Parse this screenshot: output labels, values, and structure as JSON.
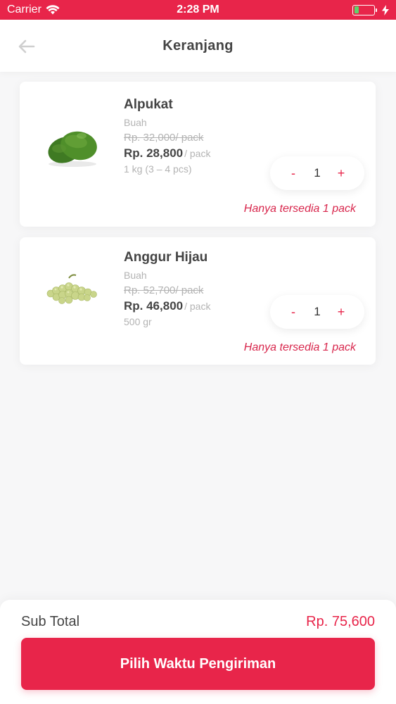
{
  "status_bar": {
    "carrier": "Carrier",
    "time": "2:28 PM",
    "battery_level_percent": 25
  },
  "header": {
    "title": "Keranjang",
    "back_icon": "arrow-left-icon"
  },
  "colors": {
    "accent": "#e8254a",
    "text_dark": "#444444",
    "text_muted": "#b3b3b3",
    "background": "#f7f7f8"
  },
  "cart_items": [
    {
      "name": "Alpukat",
      "category": "Buah",
      "original_price": "Rp. 32,000",
      "original_unit": "/ pack",
      "price": "Rp. 28,800",
      "unit": "/ pack",
      "weight": "1 kg (3 – 4 pcs)",
      "quantity": "1",
      "decrement_label": "-",
      "increment_label": "+",
      "stock_note": "Hanya tersedia 1 pack",
      "image_icon": "avocado-icon"
    },
    {
      "name": "Anggur Hijau",
      "category": "Buah",
      "original_price": "Rp. 52,700",
      "original_unit": "/ pack",
      "price": "Rp. 46,800",
      "unit": "/ pack",
      "weight": "500 gr",
      "quantity": "1",
      "decrement_label": "-",
      "increment_label": "+",
      "stock_note": "Hanya tersedia 1 pack",
      "image_icon": "green-grapes-icon"
    }
  ],
  "footer": {
    "subtotal_label": "Sub Total",
    "subtotal_value": "Rp. 75,600",
    "cta_label": "Pilih Waktu Pengiriman"
  }
}
